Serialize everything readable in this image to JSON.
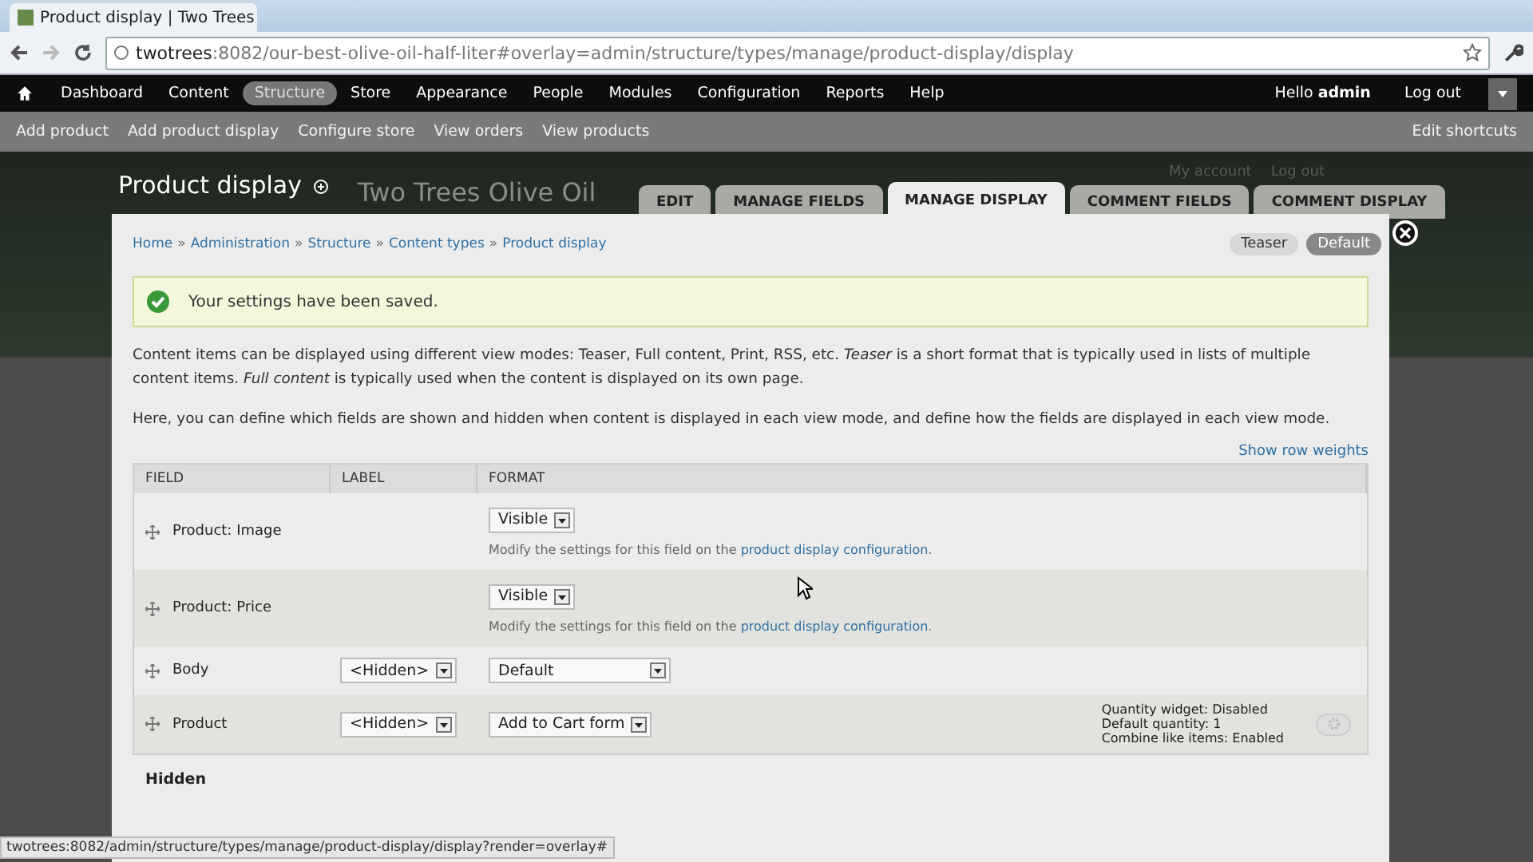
{
  "browser": {
    "tab_title": "Product display | Two Trees",
    "url_host": "twotrees",
    "url_path": ":8082/our-best-olive-oil-half-liter#overlay=admin/structure/types/manage/product-display/display"
  },
  "toolbar": {
    "items": [
      {
        "label": "Dashboard",
        "selected": false
      },
      {
        "label": "Content",
        "selected": false
      },
      {
        "label": "Structure",
        "selected": true
      },
      {
        "label": "Store",
        "selected": false
      },
      {
        "label": "Appearance",
        "selected": false
      },
      {
        "label": "People",
        "selected": false
      },
      {
        "label": "Modules",
        "selected": false
      },
      {
        "label": "Configuration",
        "selected": false
      },
      {
        "label": "Reports",
        "selected": false
      },
      {
        "label": "Help",
        "selected": false
      }
    ],
    "greeting": "Hello **admin**",
    "logout": "Log out"
  },
  "shortcuts": {
    "items": [
      "Add product",
      "Add product display",
      "Configure store",
      "View orders",
      "View products"
    ],
    "edit": "Edit shortcuts"
  },
  "page_title": "Product display",
  "site_name": "Two Trees Olive Oil",
  "secondary_links": [
    "My account",
    "Log out"
  ],
  "tabs": [
    {
      "label": "EDIT",
      "selected": false
    },
    {
      "label": "MANAGE FIELDS",
      "selected": false
    },
    {
      "label": "MANAGE DISPLAY",
      "selected": true
    },
    {
      "label": "COMMENT FIELDS",
      "selected": false
    },
    {
      "label": "COMMENT DISPLAY",
      "selected": false
    }
  ],
  "breadcrumb_separator": "»",
  "breadcrumb": [
    "Home",
    "Administration",
    "Structure",
    "Content types",
    "Product display"
  ],
  "view_modes": [
    {
      "label": "Teaser",
      "selected": false
    },
    {
      "label": "Default",
      "selected": true
    }
  ],
  "message": "Your settings have been saved.",
  "description": [
    "Content items can be displayed using different view modes: Teaser, Full content, Print, RSS, etc. *Teaser* is a short format that is typically used in lists of multiple content items. *Full content* is typically used when the content is displayed on its own page.",
    "Here, you can define which fields are shown and hidden when content is displayed in each view mode, and define how the fields are displayed in each view mode."
  ],
  "show_row_weights": "Show row weights",
  "table": {
    "columns": [
      "FIELD",
      "LABEL",
      "FORMAT"
    ],
    "rows": [
      {
        "field": "Product: Image",
        "format": "Visible",
        "note_prefix": "Modify the settings for this field on the ",
        "note_link": "product display configuration",
        "note_suffix": "."
      },
      {
        "field": "Product: Price",
        "format": "Visible",
        "note_prefix": "Modify the settings for this field on the ",
        "note_link": "product display configuration",
        "note_suffix": "."
      },
      {
        "field": "Body",
        "label": "<Hidden>",
        "format": "Default"
      },
      {
        "field": "Product",
        "label": "<Hidden>",
        "format": "Add to Cart form",
        "summary": [
          "Quantity widget: Disabled",
          "Default quantity: 1",
          "Combine like items: Enabled"
        ],
        "settings": true
      }
    ]
  },
  "hidden_heading": "Hidden",
  "status_url": "twotrees:8082/admin/structure/types/manage/product-display/display?render=overlay#"
}
